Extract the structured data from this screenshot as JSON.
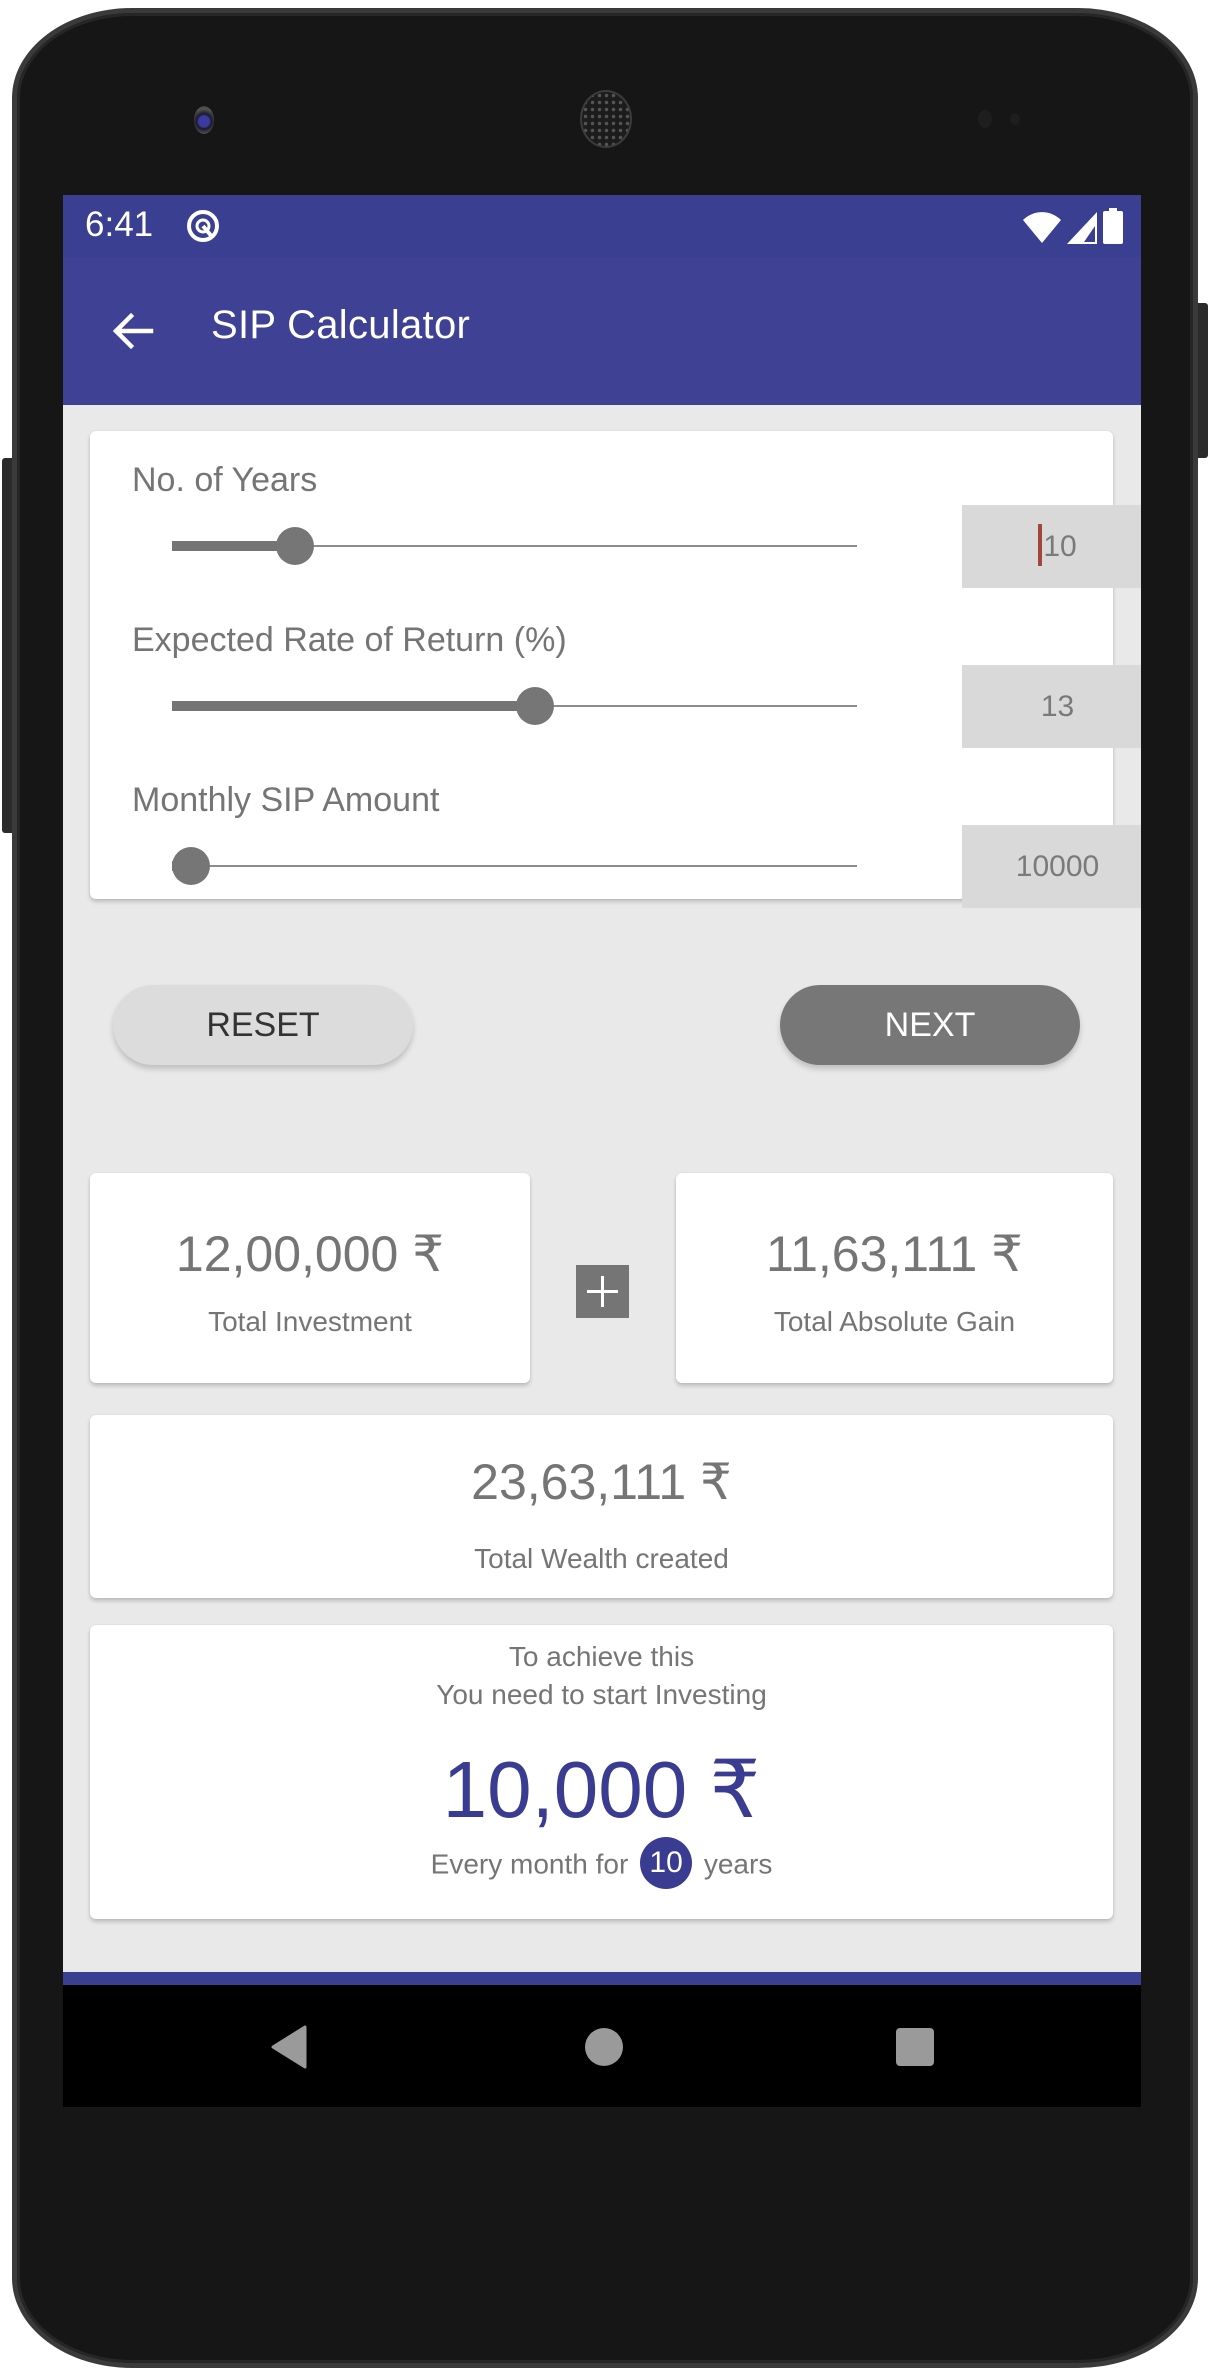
{
  "status_bar": {
    "time": "6:41",
    "left_icons": [
      "q-icon"
    ],
    "right_icons": [
      "wifi-icon",
      "signal-icon",
      "battery-icon"
    ]
  },
  "app_bar": {
    "title": "SIP Calculator",
    "back_icon": "arrow-back-icon"
  },
  "inputs": {
    "years": {
      "label": "No. of Years",
      "value": "10",
      "slider_fraction": 0.18,
      "focused": true
    },
    "rate": {
      "label": "Expected Rate of Return (%)",
      "value": "13",
      "slider_fraction": 0.53
    },
    "amount": {
      "label": "Monthly SIP Amount",
      "value": "10000",
      "slider_fraction": 0.0
    }
  },
  "buttons": {
    "reset": "RESET",
    "next": "NEXT"
  },
  "summary": {
    "investment_value": "12,00,000 ₹",
    "investment_label": "Total Investment",
    "operator_icon": "plus-icon",
    "gain_value": "11,63,111 ₹",
    "gain_label": "Total Absolute Gain",
    "wealth_value": "23,63,111 ₹",
    "wealth_label": "Total Wealth created"
  },
  "target": {
    "line1": "To achieve this",
    "line2": "You need to start Investing",
    "amount": "10,000 ₹",
    "every_prefix": "Every month for",
    "years": "10",
    "every_suffix": "years"
  },
  "colors": {
    "primary": "#3e4194",
    "status_bar": "#3b3f91",
    "accent_text": "#3a3c92",
    "background": "#e9e9e9",
    "slider": "#767676"
  },
  "nav_bar": {
    "buttons": [
      "back-triangle-icon",
      "home-circle-icon",
      "recents-square-icon"
    ]
  }
}
